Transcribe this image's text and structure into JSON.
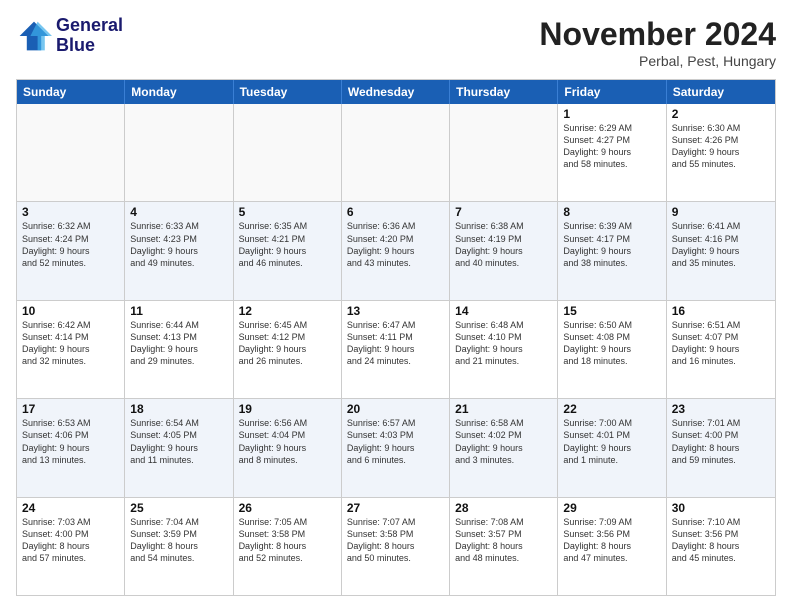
{
  "logo": {
    "text1": "General",
    "text2": "Blue"
  },
  "header": {
    "month": "November 2024",
    "location": "Perbal, Pest, Hungary"
  },
  "days": [
    "Sunday",
    "Monday",
    "Tuesday",
    "Wednesday",
    "Thursday",
    "Friday",
    "Saturday"
  ],
  "rows": [
    [
      {
        "day": "",
        "info": ""
      },
      {
        "day": "",
        "info": ""
      },
      {
        "day": "",
        "info": ""
      },
      {
        "day": "",
        "info": ""
      },
      {
        "day": "",
        "info": ""
      },
      {
        "day": "1",
        "info": "Sunrise: 6:29 AM\nSunset: 4:27 PM\nDaylight: 9 hours\nand 58 minutes."
      },
      {
        "day": "2",
        "info": "Sunrise: 6:30 AM\nSunset: 4:26 PM\nDaylight: 9 hours\nand 55 minutes."
      }
    ],
    [
      {
        "day": "3",
        "info": "Sunrise: 6:32 AM\nSunset: 4:24 PM\nDaylight: 9 hours\nand 52 minutes."
      },
      {
        "day": "4",
        "info": "Sunrise: 6:33 AM\nSunset: 4:23 PM\nDaylight: 9 hours\nand 49 minutes."
      },
      {
        "day": "5",
        "info": "Sunrise: 6:35 AM\nSunset: 4:21 PM\nDaylight: 9 hours\nand 46 minutes."
      },
      {
        "day": "6",
        "info": "Sunrise: 6:36 AM\nSunset: 4:20 PM\nDaylight: 9 hours\nand 43 minutes."
      },
      {
        "day": "7",
        "info": "Sunrise: 6:38 AM\nSunset: 4:19 PM\nDaylight: 9 hours\nand 40 minutes."
      },
      {
        "day": "8",
        "info": "Sunrise: 6:39 AM\nSunset: 4:17 PM\nDaylight: 9 hours\nand 38 minutes."
      },
      {
        "day": "9",
        "info": "Sunrise: 6:41 AM\nSunset: 4:16 PM\nDaylight: 9 hours\nand 35 minutes."
      }
    ],
    [
      {
        "day": "10",
        "info": "Sunrise: 6:42 AM\nSunset: 4:14 PM\nDaylight: 9 hours\nand 32 minutes."
      },
      {
        "day": "11",
        "info": "Sunrise: 6:44 AM\nSunset: 4:13 PM\nDaylight: 9 hours\nand 29 minutes."
      },
      {
        "day": "12",
        "info": "Sunrise: 6:45 AM\nSunset: 4:12 PM\nDaylight: 9 hours\nand 26 minutes."
      },
      {
        "day": "13",
        "info": "Sunrise: 6:47 AM\nSunset: 4:11 PM\nDaylight: 9 hours\nand 24 minutes."
      },
      {
        "day": "14",
        "info": "Sunrise: 6:48 AM\nSunset: 4:10 PM\nDaylight: 9 hours\nand 21 minutes."
      },
      {
        "day": "15",
        "info": "Sunrise: 6:50 AM\nSunset: 4:08 PM\nDaylight: 9 hours\nand 18 minutes."
      },
      {
        "day": "16",
        "info": "Sunrise: 6:51 AM\nSunset: 4:07 PM\nDaylight: 9 hours\nand 16 minutes."
      }
    ],
    [
      {
        "day": "17",
        "info": "Sunrise: 6:53 AM\nSunset: 4:06 PM\nDaylight: 9 hours\nand 13 minutes."
      },
      {
        "day": "18",
        "info": "Sunrise: 6:54 AM\nSunset: 4:05 PM\nDaylight: 9 hours\nand 11 minutes."
      },
      {
        "day": "19",
        "info": "Sunrise: 6:56 AM\nSunset: 4:04 PM\nDaylight: 9 hours\nand 8 minutes."
      },
      {
        "day": "20",
        "info": "Sunrise: 6:57 AM\nSunset: 4:03 PM\nDaylight: 9 hours\nand 6 minutes."
      },
      {
        "day": "21",
        "info": "Sunrise: 6:58 AM\nSunset: 4:02 PM\nDaylight: 9 hours\nand 3 minutes."
      },
      {
        "day": "22",
        "info": "Sunrise: 7:00 AM\nSunset: 4:01 PM\nDaylight: 9 hours\nand 1 minute."
      },
      {
        "day": "23",
        "info": "Sunrise: 7:01 AM\nSunset: 4:00 PM\nDaylight: 8 hours\nand 59 minutes."
      }
    ],
    [
      {
        "day": "24",
        "info": "Sunrise: 7:03 AM\nSunset: 4:00 PM\nDaylight: 8 hours\nand 57 minutes."
      },
      {
        "day": "25",
        "info": "Sunrise: 7:04 AM\nSunset: 3:59 PM\nDaylight: 8 hours\nand 54 minutes."
      },
      {
        "day": "26",
        "info": "Sunrise: 7:05 AM\nSunset: 3:58 PM\nDaylight: 8 hours\nand 52 minutes."
      },
      {
        "day": "27",
        "info": "Sunrise: 7:07 AM\nSunset: 3:58 PM\nDaylight: 8 hours\nand 50 minutes."
      },
      {
        "day": "28",
        "info": "Sunrise: 7:08 AM\nSunset: 3:57 PM\nDaylight: 8 hours\nand 48 minutes."
      },
      {
        "day": "29",
        "info": "Sunrise: 7:09 AM\nSunset: 3:56 PM\nDaylight: 8 hours\nand 47 minutes."
      },
      {
        "day": "30",
        "info": "Sunrise: 7:10 AM\nSunset: 3:56 PM\nDaylight: 8 hours\nand 45 minutes."
      }
    ]
  ]
}
